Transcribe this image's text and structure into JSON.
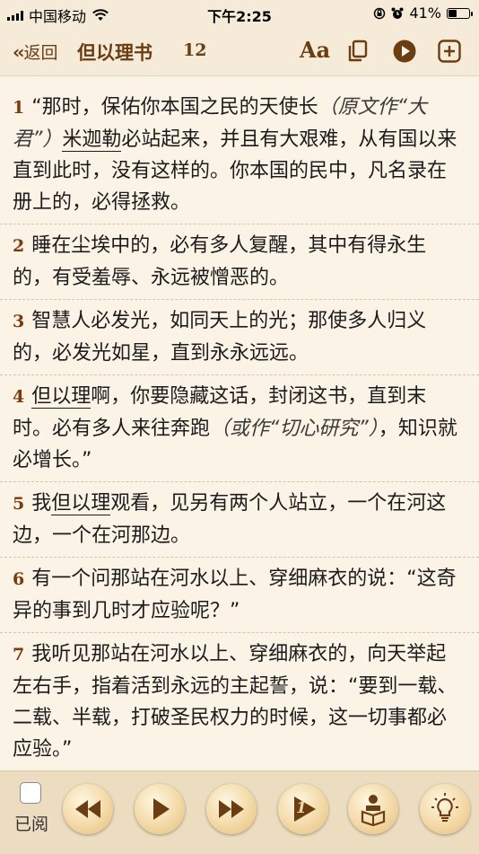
{
  "status_bar": {
    "carrier": "中国移动",
    "time": "下午2:25",
    "battery": "41%",
    "battery_level": 0.41
  },
  "nav": {
    "back_label": "返回",
    "book_title": "但以理书",
    "chapter": "12",
    "font_label": "Aa"
  },
  "verses": [
    {
      "num": "1",
      "parts": [
        {
          "t": "“那时，保佑你本国之民的天使长"
        },
        {
          "t": "（原文作“大君”）",
          "i": true
        },
        {
          "t": "米迦勒",
          "u": true
        },
        {
          "t": "必站起来，并且有大艰难，从有国以来直到此时，没有这样的。你本国的民中，凡名录在册上的，必得拯救。"
        }
      ]
    },
    {
      "num": "2",
      "parts": [
        {
          "t": "睡在尘埃中的，必有多人复醒，其中有得永生的，有受羞辱、永远被憎恶的。"
        }
      ]
    },
    {
      "num": "3",
      "parts": [
        {
          "t": "智慧人必发光，如同天上的光；那使多人归义的，必发光如星，直到永永远远。"
        }
      ]
    },
    {
      "num": "4",
      "parts": [
        {
          "t": "但以理",
          "u": true
        },
        {
          "t": "啊，你要隐藏这话，封闭这书，直到末时。必有多人来往奔跑"
        },
        {
          "t": "（或作“切心研究”）",
          "i": true
        },
        {
          "t": "，知识就必增长。”"
        }
      ]
    },
    {
      "num": "5",
      "parts": [
        {
          "t": "我"
        },
        {
          "t": "但以理",
          "u": true
        },
        {
          "t": "观看，见另有两个人站立，一个在河这边，一个在河那边。"
        }
      ]
    },
    {
      "num": "6",
      "parts": [
        {
          "t": "有一个问那站在河水以上、穿细麻衣的说：“这奇异的事到几时才应验呢？”"
        }
      ]
    },
    {
      "num": "7",
      "parts": [
        {
          "t": "我听见那站在河水以上、穿细麻衣的，向天举起左右手，指着活到永远的主起誓，说：“要到一载、二载、半载，打破圣民权力的时候，这一切事都必应验。”"
        }
      ]
    }
  ],
  "toolbar": {
    "read_label": "已阅",
    "chapter_badge": "1"
  }
}
